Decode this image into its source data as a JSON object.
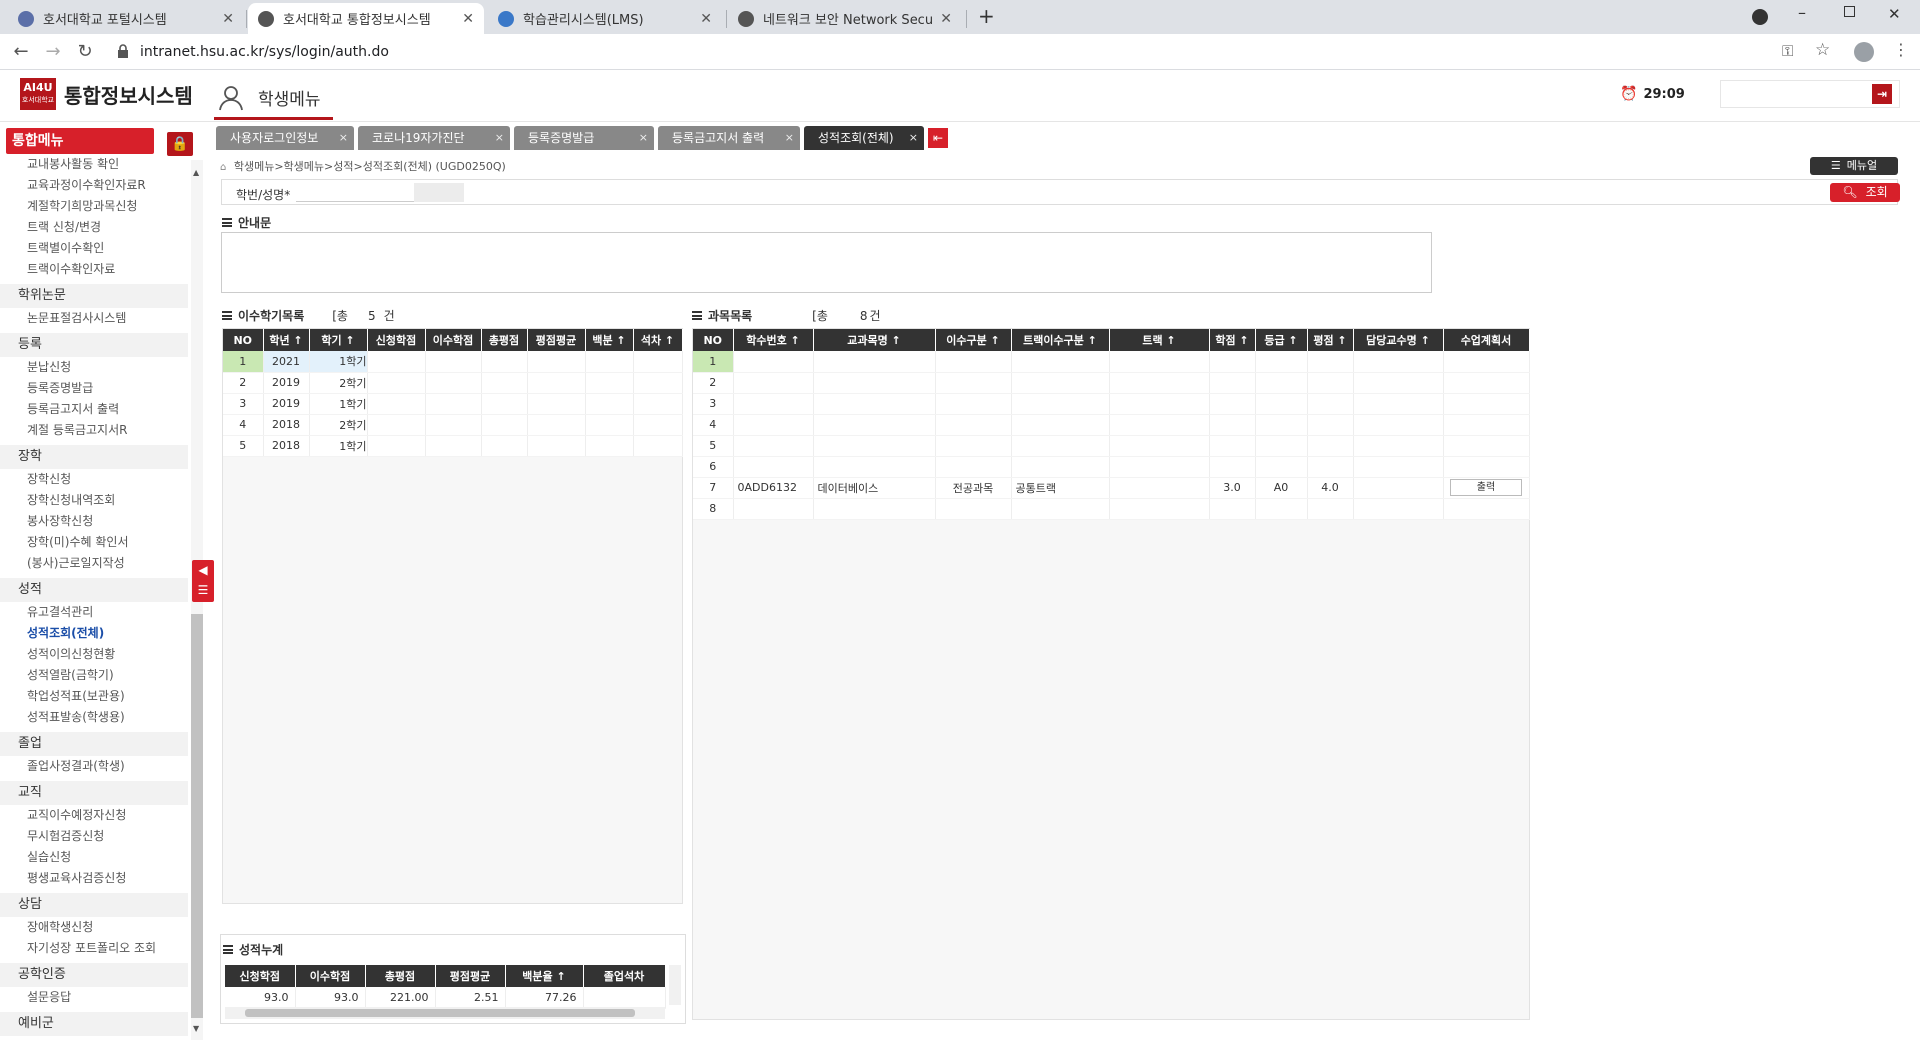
{
  "browser": {
    "tabs": [
      {
        "title": "호서대학교 포털시스템"
      },
      {
        "title": "호서대학교 통합정보시스템"
      },
      {
        "title": "학습관리시스템(LMS)"
      },
      {
        "title": "네트워크 보안 Network Security"
      }
    ],
    "url": "intranet.hsu.ac.kr/sys/login/auth.do"
  },
  "header": {
    "logo_text": "AI4U",
    "logo_sub": "호서대학교",
    "system_title": "통합정보시스템",
    "student_menu": "학생메뉴",
    "timer": "29:09"
  },
  "sidebar": {
    "title": "통합메뉴",
    "items": [
      {
        "type": "item",
        "label": "교내봉사활동 확인"
      },
      {
        "type": "item",
        "label": "교육과정이수확인자료R"
      },
      {
        "type": "item",
        "label": "계절학기희망과목신청"
      },
      {
        "type": "item",
        "label": "트랙 신청/변경"
      },
      {
        "type": "item",
        "label": "트랙별이수확인"
      },
      {
        "type": "item",
        "label": "트랙이수확인자료"
      },
      {
        "type": "cat",
        "label": "학위논문"
      },
      {
        "type": "item",
        "label": "논문표절검사시스템"
      },
      {
        "type": "cat",
        "label": "등록"
      },
      {
        "type": "item",
        "label": "분납신청"
      },
      {
        "type": "item",
        "label": "등록증명발급"
      },
      {
        "type": "item",
        "label": "등록금고지서 출력"
      },
      {
        "type": "item",
        "label": "계절 등록금고지서R"
      },
      {
        "type": "cat",
        "label": "장학"
      },
      {
        "type": "item",
        "label": "장학신청"
      },
      {
        "type": "item",
        "label": "장학신청내역조회"
      },
      {
        "type": "item",
        "label": "봉사장학신청"
      },
      {
        "type": "item",
        "label": "장학(미)수혜 확인서"
      },
      {
        "type": "item",
        "label": "(봉사)근로일지작성"
      },
      {
        "type": "cat",
        "label": "성적"
      },
      {
        "type": "item",
        "label": "유고결석관리"
      },
      {
        "type": "item",
        "label": "성적조회(전체)",
        "selected": true
      },
      {
        "type": "item",
        "label": "성적이의신청현황"
      },
      {
        "type": "item",
        "label": "성적열람(금학기)"
      },
      {
        "type": "item",
        "label": "학업성적표(보관용)"
      },
      {
        "type": "item",
        "label": "성적표발송(학생용)"
      },
      {
        "type": "cat",
        "label": "졸업"
      },
      {
        "type": "item",
        "label": "졸업사정결과(학생)"
      },
      {
        "type": "cat",
        "label": "교직"
      },
      {
        "type": "item",
        "label": "교직이수예정자신청"
      },
      {
        "type": "item",
        "label": "무시험검증신청"
      },
      {
        "type": "item",
        "label": "실습신청"
      },
      {
        "type": "item",
        "label": "평생교육사검증신청"
      },
      {
        "type": "cat",
        "label": "상담"
      },
      {
        "type": "item",
        "label": "장애학생신청"
      },
      {
        "type": "item",
        "label": "자기성장 포트폴리오 조회"
      },
      {
        "type": "cat",
        "label": "공학인증"
      },
      {
        "type": "item",
        "label": "설문응답"
      },
      {
        "type": "cat",
        "label": "예비군"
      }
    ]
  },
  "content_tabs": [
    {
      "label": "사용자로그인정보"
    },
    {
      "label": "코로나19자가진단"
    },
    {
      "label": "등록증명발급"
    },
    {
      "label": "등록금고지서 출력"
    },
    {
      "label": "성적조회(전체)",
      "active": true
    }
  ],
  "breadcrumb": "학생메뉴>학생메뉴>성적>성적조회(전체) (UGD0250Q)",
  "manual_label": "메뉴얼",
  "search": {
    "id_label": "학번/성명*",
    "button": "조회"
  },
  "notice_title": "안내문",
  "semesters": {
    "title": "이수학기목록",
    "count_prefix": "[총",
    "count": "5",
    "count_suffix": "건",
    "columns": [
      "NO",
      "학년",
      "학기",
      "신청학점",
      "이수학점",
      "총평점",
      "평점평균",
      "백분",
      "석차"
    ],
    "rows": [
      [
        "1",
        "2021",
        "1학기"
      ],
      [
        "2",
        "2019",
        "2학기"
      ],
      [
        "3",
        "2019",
        "1학기"
      ],
      [
        "4",
        "2018",
        "2학기"
      ],
      [
        "5",
        "2018",
        "1학기"
      ]
    ]
  },
  "courses": {
    "title": "과목목록",
    "count_prefix": "[총",
    "count": "8",
    "count_suffix": "건",
    "columns": [
      "NO",
      "학수번호",
      "교과목명",
      "이수구분",
      "트랙이수구분",
      "트랙",
      "학점",
      "등급",
      "평점",
      "담당교수명",
      "수업계획서"
    ],
    "rows": [
      [
        "1",
        "",
        "",
        "",
        "",
        "",
        "",
        "",
        "",
        "",
        ""
      ],
      [
        "2",
        "",
        "",
        "",
        "",
        "",
        "",
        "",
        "",
        "",
        ""
      ],
      [
        "3",
        "",
        "",
        "",
        "",
        "",
        "",
        "",
        "",
        "",
        ""
      ],
      [
        "4",
        "",
        "",
        "",
        "",
        "",
        "",
        "",
        "",
        "",
        ""
      ],
      [
        "5",
        "",
        "",
        "",
        "",
        "",
        "",
        "",
        "",
        "",
        ""
      ],
      [
        "6",
        "",
        "",
        "",
        "",
        "",
        "",
        "",
        "",
        "",
        ""
      ],
      [
        "7",
        "0ADD6132",
        "데이터베이스",
        "전공과목",
        "공통트랙",
        "",
        "3.0",
        "A0",
        "4.0",
        "",
        "출력"
      ],
      [
        "8",
        "",
        "",
        "",
        "",
        "",
        "",
        "",
        "",
        "",
        ""
      ]
    ]
  },
  "summary": {
    "title": "성적누계",
    "columns": [
      "신청학점",
      "이수학점",
      "총평점",
      "평점평균",
      "백분율",
      "졸업석차"
    ],
    "row": [
      "93.0",
      "93.0",
      "221.00",
      "2.51",
      "77.26",
      ""
    ]
  },
  "colors": {
    "accent": "#d7202a",
    "header_dark": "#333333",
    "selected_green": "#c9e8b3"
  }
}
